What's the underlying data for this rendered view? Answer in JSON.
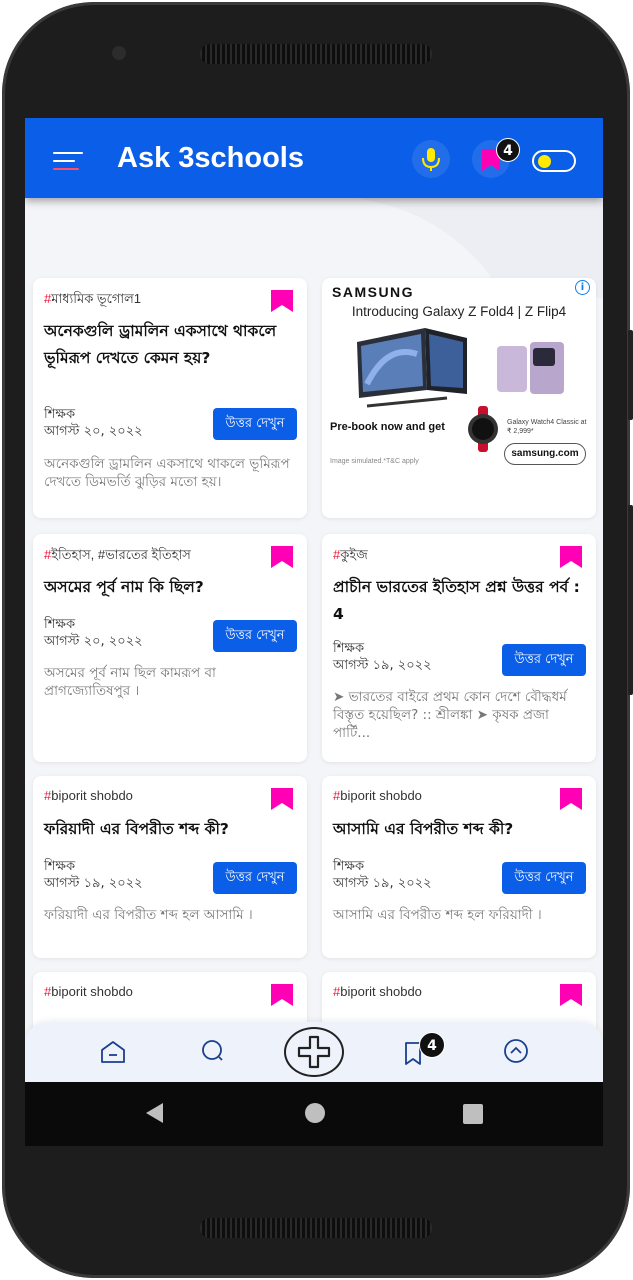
{
  "app": {
    "title": "Ask 3schools"
  },
  "header": {
    "menu_icon": "hamburger-menu-icon",
    "mic_icon": "microphone-icon",
    "bookmark_icon": "bookmark-icon",
    "bookmark_count": "4",
    "theme_toggle": "theme-toggle"
  },
  "colors": {
    "primary": "#0a5ee8",
    "bookmark": "#ff00b4",
    "hash": "#e8173a",
    "toggle_knob": "#ffea00"
  },
  "cards": [
    {
      "hash": "#",
      "tag": "মাধ্যমিক ভূগোল1",
      "title": "অনেকগুলি ড্রামলিন একসাথে থাকলে ভূমিরূপ দেখতে কেমন হয়?",
      "author": "শিক্ষক",
      "date": "আগস্ট ২০, ২০২২",
      "button": "উত্তর দেখুন",
      "excerpt": "অনেকগুলি ড্রামলিন একসাথে থাকলে ভূমিরূপ দেখতে ডিমভর্তি ঝুড়ির মতো হয়।"
    },
    {
      "hash": "#",
      "tag": "ইতিহাস, #ভারতের ইতিহাস",
      "title": "অসমের পূর্ব নাম কি ছিল?",
      "author": "শিক্ষক",
      "date": "আগস্ট ২০, ২০২২",
      "button": "উত্তর দেখুন",
      "excerpt": "অসমের পূর্ব নাম ছিল কামরূপ বা প্রাগজ্যোতিষপুর ।"
    },
    {
      "hash": "#",
      "tag": "কুইজ",
      "title": "প্রাচীন ভারতের ইতিহাস প্রশ্ন উত্তর পর্ব : 4",
      "author": "শিক্ষক",
      "date": "আগস্ট ১৯, ২০২২",
      "button": "উত্তর দেখুন",
      "excerpt": "➤ ভারতের বাইরে প্রথম কোন দেশে বৌদ্ধধর্ম বিস্তৃত হয়েছিল? :: শ্রীলঙ্কা ➤ কৃষক প্রজা পার্টি..."
    },
    {
      "hash": "#",
      "tag": "biporit shobdo",
      "title": "ফরিয়াদী এর বিপরীত শব্দ কী?",
      "author": "শিক্ষক",
      "date": "আগস্ট ১৯, ২০২২",
      "button": "উত্তর দেখুন",
      "excerpt": "ফরিয়াদী এর বিপরীত শব্দ হল আসামি ।"
    },
    {
      "hash": "#",
      "tag": "biporit shobdo",
      "title": "আসামি এর বিপরীত শব্দ কী?",
      "author": "শিক্ষক",
      "date": "আগস্ট ১৯, ২০২২",
      "button": "উত্তর দেখুন",
      "excerpt": "আসামি এর বিপরীত শব্দ হল ফরিয়াদী ।"
    },
    {
      "hash": "#",
      "tag": "biporit shobdo"
    },
    {
      "hash": "#",
      "tag": "biporit shobdo"
    }
  ],
  "ad": {
    "brand": "SAMSUNG",
    "headline": "Introducing Galaxy Z Fold4 | Z Flip4",
    "prebook": "Pre-book now and get",
    "watch_label": "Galaxy Watch4 Classic at ₹ 2,999*",
    "disclaimer": "Image simulated.*T&C apply",
    "url": "samsung.com",
    "info": "i"
  },
  "bottom_nav": {
    "items": [
      "home-icon",
      "search-icon",
      "add-icon",
      "bookmark-icon",
      "scroll-top-icon"
    ],
    "bookmark_count": "4"
  },
  "system_nav": {
    "items": [
      "back-icon",
      "home-circle-icon",
      "recents-icon"
    ]
  }
}
